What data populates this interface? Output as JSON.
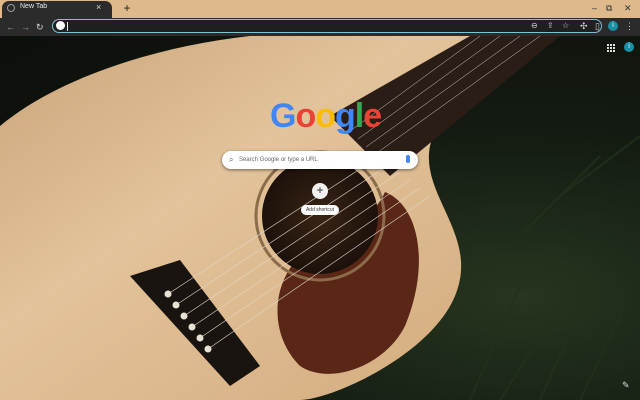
{
  "tab": {
    "title": "New Tab",
    "close": "×",
    "new_tab": "+"
  },
  "window": {
    "minimize": "–",
    "restore": "⧉",
    "close": "✕"
  },
  "toolbar": {
    "back": "←",
    "forward": "→",
    "reload": "↻",
    "profile_initial": "i"
  },
  "search": {
    "placeholder": "Search Google or type a URL"
  },
  "logo": {
    "letters": [
      "G",
      "o",
      "o",
      "g",
      "l",
      "e"
    ],
    "colors": [
      "#4285f4",
      "#ea4335",
      "#fbbc05",
      "#4285f4",
      "#34a853",
      "#ea4335"
    ]
  },
  "shortcut": {
    "label": "Add shortcut",
    "plus": "+"
  },
  "ntp": {
    "profile_initial": "i",
    "customize_icon": "✎"
  }
}
